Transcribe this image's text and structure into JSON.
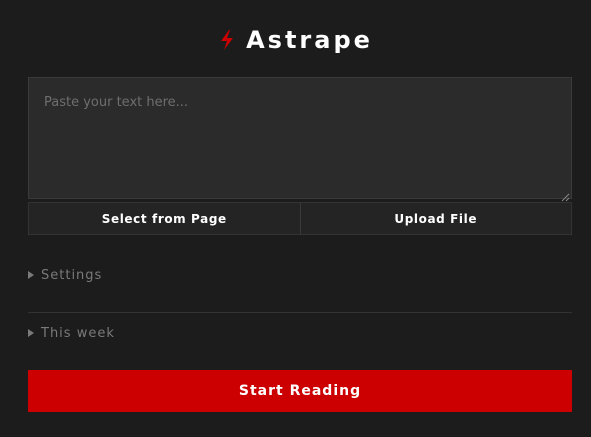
{
  "app": {
    "title": "Astrape",
    "logo_icon": "lightning-bolt-icon",
    "accent_color": "#cc0000"
  },
  "input": {
    "placeholder": "Paste your text here...",
    "value": ""
  },
  "actions": {
    "select_label": "Select from Page",
    "upload_label": "Upload File"
  },
  "sections": {
    "settings_label": "Settings",
    "week_label": "This week",
    "expand_icon": "triangle-right-icon"
  },
  "start": {
    "label": "Start Reading"
  }
}
